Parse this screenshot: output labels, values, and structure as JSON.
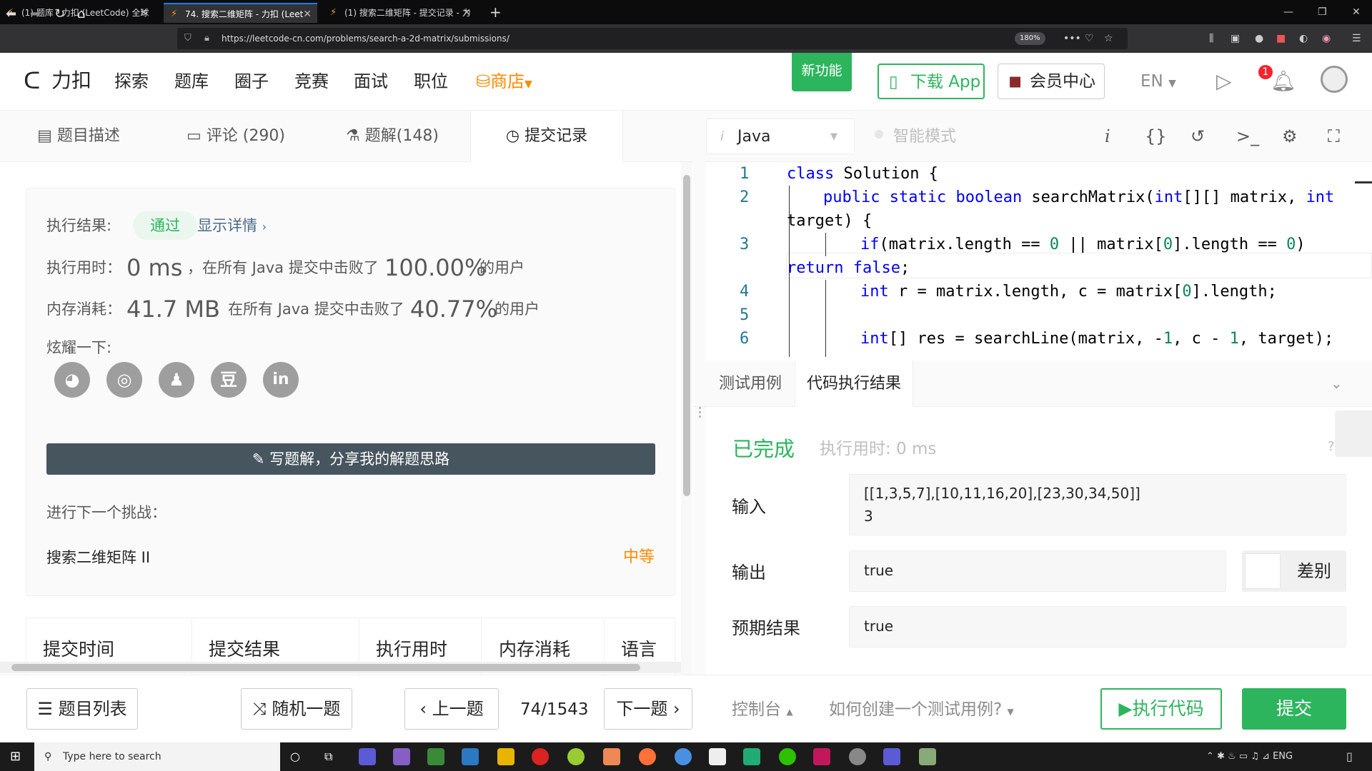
{
  "browser": {
    "tabs": [
      {
        "title": "(1) 题库 - 力扣 (LeetCode) 全球"
      },
      {
        "title": "74. 搜索二维矩阵 - 力扣 (Leet"
      },
      {
        "title": "(1) 搜索二维矩阵 - 提交记录 - 力"
      }
    ],
    "url": "https://leetcode-cn.com/problems/search-a-2d-matrix/submissions/",
    "zoom": "180%"
  },
  "header": {
    "logo": "力扣",
    "nav": [
      "探索",
      "题库",
      "圈子",
      "竞赛",
      "面试",
      "职位"
    ],
    "shop": "商店",
    "new_feature": "新功能",
    "download_app": "下载 App",
    "vip": "会员中心",
    "lang": "EN",
    "notify_count": "1"
  },
  "left": {
    "tabs": [
      "题目描述",
      "评论 (290)",
      "题解(148)",
      "提交记录"
    ],
    "result_label": "执行结果:",
    "result": "通过",
    "details": "显示详情",
    "time_label": "执行用时：",
    "time_value": "0 ms",
    "time_mid": "，在所有 Java 提交中击败了",
    "time_pct": "100.00%",
    "time_tail": "的用户",
    "mem_label": "内存消耗：",
    "mem_value": "41.7 MB",
    "mem_mid": "，在所有 Java 提交中击败了",
    "mem_pct": "40.77%",
    "mem_tail": "的用户",
    "share_label": "炫耀一下:",
    "share_icons": [
      "wechat-icon",
      "weibo-icon",
      "qq-icon",
      "douban-icon",
      "linkedin-icon"
    ],
    "write_btn": "写题解，分享我的解题思路",
    "next_label": "进行下一个挑战：",
    "next_title": "搜索二维矩阵 II",
    "next_difficulty": "中等",
    "table_headers": [
      "提交时间",
      "提交结果",
      "执行用时",
      "内存消耗",
      "语言"
    ]
  },
  "editor": {
    "language": "Java",
    "smart_mode": "智能模式",
    "line_numbers": [
      "1",
      "2",
      "3",
      "4",
      "5",
      "6"
    ]
  },
  "result": {
    "tabs": [
      "测试用例",
      "代码执行结果"
    ],
    "status": "已完成",
    "time": "执行用时: 0 ms",
    "input_label": "输入",
    "input_line1": "[[1,3,5,7],[10,11,16,20],[23,30,34,50]]",
    "input_line2": "3",
    "output_label": "输出",
    "output": "true",
    "diff": "差别",
    "expected_label": "预期结果",
    "expected": "true"
  },
  "footer": {
    "problem_list": "题目列表",
    "random": "随机一题",
    "prev": "上一题",
    "page": "74/1543",
    "next": "下一题",
    "console": "控制台",
    "howto": "如何创建一个测试用例?",
    "run": "执行代码",
    "submit": "提交"
  },
  "taskbar": {
    "search_placeholder": "Type here to search",
    "lang": "ENG"
  },
  "colors": {
    "accent": "#2db55d",
    "orange": "#ff8a00",
    "keyword": "#0000ff",
    "number": "#098658"
  }
}
